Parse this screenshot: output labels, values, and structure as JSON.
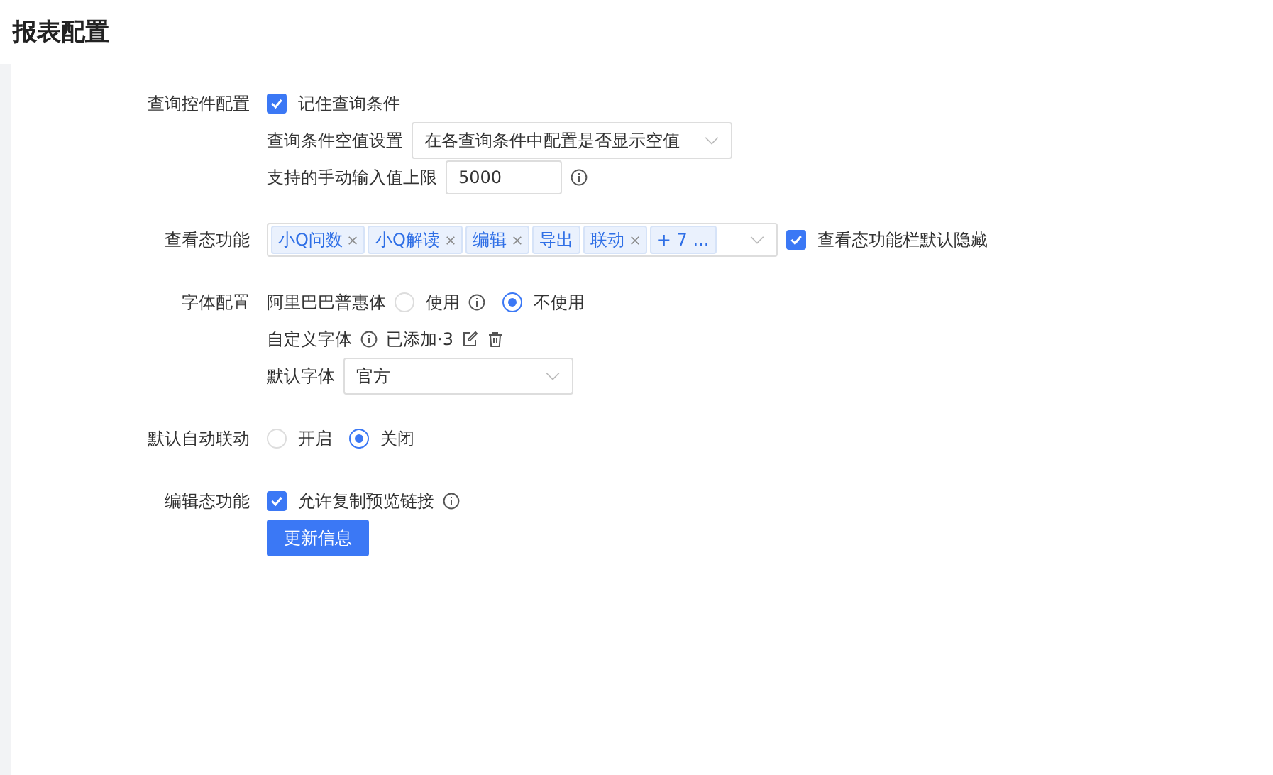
{
  "page_title": "报表配置",
  "query_config": {
    "label": "查询控件配置",
    "remember": {
      "label": "记住查询条件",
      "checked": true
    },
    "empty_value": {
      "label": "查询条件空值设置",
      "value": "在各查询条件中配置是否显示空值"
    },
    "input_limit": {
      "label": "支持的手动输入值上限",
      "value": "5000"
    }
  },
  "view_features": {
    "label": "查看态功能",
    "tags": [
      {
        "label": "小Q问数",
        "closable": true
      },
      {
        "label": "小Q解读",
        "closable": true
      },
      {
        "label": "编辑",
        "closable": true
      },
      {
        "label": "导出",
        "closable": false
      },
      {
        "label": "联动",
        "closable": true
      },
      {
        "label": "+ 7 ...",
        "closable": false
      }
    ],
    "hide_default": {
      "label": "查看态功能栏默认隐藏",
      "checked": true
    }
  },
  "font_config": {
    "label": "字体配置",
    "alibaba": {
      "label": "阿里巴巴普惠体",
      "options": [
        {
          "label": "使用",
          "info": true,
          "selected": false
        },
        {
          "label": "不使用",
          "info": false,
          "selected": true
        }
      ]
    },
    "custom": {
      "label": "自定义字体",
      "status": "已添加·3"
    },
    "default_font": {
      "label": "默认字体",
      "value": "官方"
    }
  },
  "auto_link": {
    "label": "默认自动联动",
    "options": [
      {
        "label": "开启",
        "selected": false
      },
      {
        "label": "关闭",
        "selected": true
      }
    ]
  },
  "edit_features": {
    "label": "编辑态功能",
    "allow_copy": {
      "label": "允许复制预览链接",
      "checked": true
    }
  },
  "submit": "更新信息"
}
